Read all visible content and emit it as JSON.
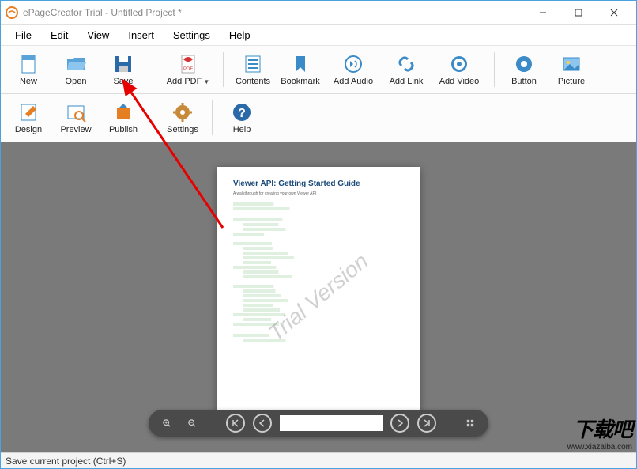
{
  "window": {
    "title": "ePageCreator Trial - Untitled Project *"
  },
  "menu": {
    "file": "File",
    "edit": "Edit",
    "view": "View",
    "insert": "Insert",
    "settings": "Settings",
    "help": "Help"
  },
  "toolbar1": {
    "new": "New",
    "open": "Open",
    "save": "Save",
    "addpdf": "Add PDF",
    "contents": "Contents",
    "bookmark": "Bookmark",
    "addaudio": "Add Audio",
    "addlink": "Add Link",
    "addvideo": "Add Video",
    "button": "Button",
    "picture": "Picture"
  },
  "toolbar2": {
    "design": "Design",
    "preview": "Preview",
    "publish": "Publish",
    "settings": "Settings",
    "help": "Help"
  },
  "document": {
    "title": "Viewer API: Getting Started Guide",
    "subtitle": "A walkthrough for creating your own Viewer API",
    "watermark": "Trial Version"
  },
  "player": {
    "page_input": ""
  },
  "status": {
    "text": "Save current project (Ctrl+S)"
  },
  "branding": {
    "text": "下载吧",
    "url": "www.xiazaiba.com"
  }
}
